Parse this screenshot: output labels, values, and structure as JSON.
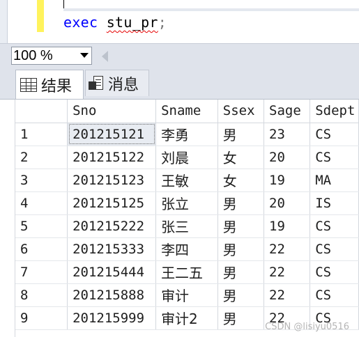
{
  "editor": {
    "keyword": "exec",
    "procedure": "stu_pr",
    "terminator": ";"
  },
  "zoom": {
    "value": "100 %"
  },
  "tabs": [
    {
      "label": "结果",
      "icon": "grid-icon"
    },
    {
      "label": "消息",
      "icon": "messages-icon"
    }
  ],
  "grid": {
    "columns": [
      "Sno",
      "Sname",
      "Ssex",
      "Sage",
      "Sdept"
    ],
    "rows": [
      {
        "num": "1",
        "cells": [
          "201215121",
          "李勇",
          "男",
          "23",
          "CS"
        ]
      },
      {
        "num": "2",
        "cells": [
          "201215122",
          "刘晨",
          "女",
          "20",
          "CS"
        ]
      },
      {
        "num": "3",
        "cells": [
          "201215123",
          "王敏",
          "女",
          "19",
          "MA"
        ]
      },
      {
        "num": "4",
        "cells": [
          "201215125",
          "张立",
          "男",
          "20",
          "IS"
        ]
      },
      {
        "num": "5",
        "cells": [
          "201215222",
          "张三",
          "男",
          "19",
          "CS"
        ]
      },
      {
        "num": "6",
        "cells": [
          "201215333",
          "李四",
          "男",
          "22",
          "CS"
        ]
      },
      {
        "num": "7",
        "cells": [
          "201215444",
          "王二五",
          "男",
          "22",
          "CS"
        ]
      },
      {
        "num": "8",
        "cells": [
          "201215888",
          "审计",
          "男",
          "22",
          "CS"
        ]
      },
      {
        "num": "9",
        "cells": [
          "201215999",
          "审计2",
          "男",
          "22",
          "CS"
        ]
      }
    ]
  },
  "watermark": "CSDN @lisiyu0516",
  "colors": {
    "keyword": "#0000ff",
    "change_bar": "#fff35c",
    "squiggle": "#e60000",
    "toolbar_bg": "#dfe3eb"
  }
}
